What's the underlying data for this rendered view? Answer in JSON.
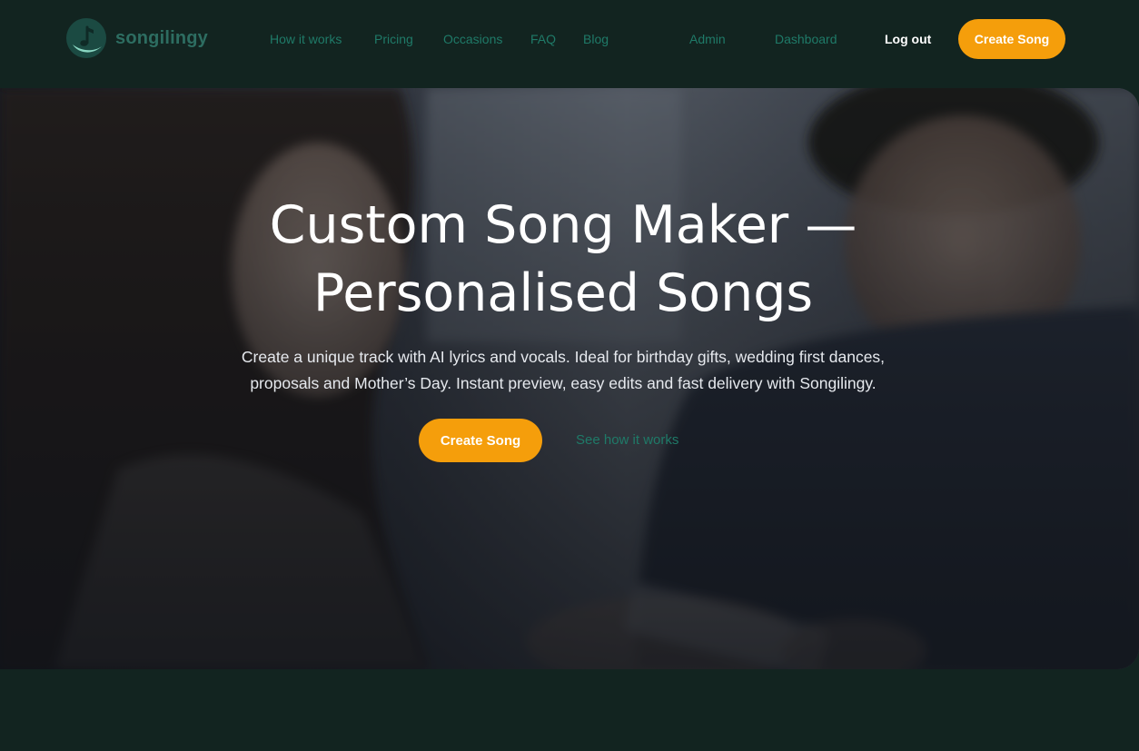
{
  "brand": {
    "name": "songilingy",
    "logo_icon": "music-note-icon"
  },
  "nav": {
    "links": [
      "How it works",
      "Pricing",
      "Occasions",
      "FAQ",
      "Blog"
    ],
    "admin": "Admin",
    "dashboard": "Dashboard",
    "logout": "Log out",
    "create_song": "Create Song"
  },
  "hero": {
    "title_line1": "Custom Song Maker —",
    "title_line2": "Personalised Songs",
    "subtitle_line1": "Create a unique track with AI lyrics and vocals. Ideal for birthday gifts, wedding first dances,",
    "subtitle_line2": "proposals and Mother’s Day. Instant preview, easy edits and fast delivery with Songilingy.",
    "cta_primary": "Create Song",
    "cta_secondary": "See how it works"
  },
  "colors": {
    "background": "#122420",
    "accent": "#f59e0b",
    "nav_link": "#1f7a68",
    "brand": "#2d6d61"
  }
}
